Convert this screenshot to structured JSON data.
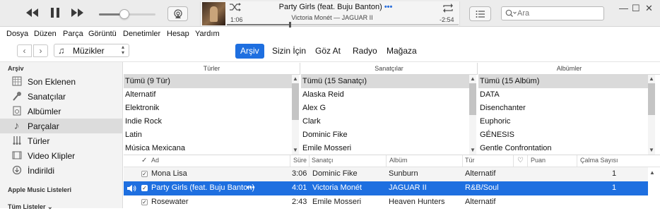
{
  "player": {
    "prev_icon": "rewind-icon",
    "pause_icon": "pause-icon",
    "next_icon": "fast-forward-icon",
    "airplay_icon": "airplay-icon",
    "song_title": "Party Girls (feat. Buju Banton)",
    "song_more": "•••",
    "song_subtitle": "Victoria Monét — JAGUAR II",
    "elapsed": "1:06",
    "remaining": "-2:54",
    "progress_fraction": 0.27,
    "volume_fraction": 0.45,
    "shuffle_icon": "shuffle-icon",
    "repeat_icon": "repeat-icon",
    "list_icon": "list-icon",
    "search_placeholder": "Ara"
  },
  "window": {
    "minimize": "—",
    "maximize": "☐",
    "close": "✕"
  },
  "menu": [
    "Dosya",
    "Düzen",
    "Parça",
    "Görüntü",
    "Denetimler",
    "Hesap",
    "Yardım"
  ],
  "nav": {
    "back": "‹",
    "forward": "›",
    "media_label": "Müzikler",
    "tabs": [
      {
        "label": "Arşiv",
        "active": true
      },
      {
        "label": "Sizin İçin",
        "active": false
      },
      {
        "label": "Göz At",
        "active": false
      },
      {
        "label": "Radyo",
        "active": false
      },
      {
        "label": "Mağaza",
        "active": false
      }
    ]
  },
  "sidebar": {
    "section_library": "Arşiv",
    "items": [
      {
        "label": "Son Eklenen",
        "icon": "recently-added-icon"
      },
      {
        "label": "Sanatçılar",
        "icon": "microphone-icon"
      },
      {
        "label": "Albümler",
        "icon": "album-icon"
      },
      {
        "label": "Parçalar",
        "icon": "music-note-icon"
      },
      {
        "label": "Türler",
        "icon": "genres-icon"
      },
      {
        "label": "Video Klipler",
        "icon": "video-icon"
      },
      {
        "label": "İndirildi",
        "icon": "download-icon"
      }
    ],
    "section_playlists": "Apple Music Listeleri",
    "section_all_playlists": "Tüm Listeler ⌄"
  },
  "browser": {
    "genres": {
      "header": "Türler",
      "rows": [
        "Tümü (9 Tür)",
        "Alternatif",
        "Elektronik",
        "Indie Rock",
        "Latin",
        "Música Mexicana"
      ]
    },
    "artists": {
      "header": "Sanatçılar",
      "rows": [
        "Tümü (15 Sanatçı)",
        "Alaska Reid",
        "Alex G",
        "Clark",
        "Dominic Fike",
        "Emile Mosseri"
      ]
    },
    "albums": {
      "header": "Albümler",
      "rows": [
        "Tümü (15 Albüm)",
        "DATA",
        "Disenchanter",
        "Euphoric",
        "GÉNESIS",
        "Gentle Confrontation"
      ]
    }
  },
  "table": {
    "headers": {
      "check": "✓",
      "name": "Ad",
      "time": "Süre",
      "artist": "Sanatçı",
      "album": "Albüm",
      "genre": "Tür",
      "heart": "♡",
      "rating": "Puan",
      "plays": "Çalma Sayısı"
    },
    "rows": [
      {
        "name": "Mona Lisa",
        "time": "3:06",
        "artist": "Dominic Fike",
        "album": "Sunburn",
        "genre": "Alternatif",
        "plays": "1",
        "checked": "✓",
        "more": ""
      },
      {
        "name": "Party Girls (feat. Buju Banton)",
        "time": "4:01",
        "artist": "Victoria Monét",
        "album": "JAGUAR II",
        "genre": "R&B/Soul",
        "plays": "1",
        "checked": "✓",
        "more": "•••"
      },
      {
        "name": "Rosewater",
        "time": "2:43",
        "artist": "Emile Mosseri",
        "album": "Heaven Hunters",
        "genre": "Alternatif",
        "plays": "",
        "checked": "✓",
        "more": ""
      }
    ],
    "speaker_icon": "speaker-icon"
  }
}
